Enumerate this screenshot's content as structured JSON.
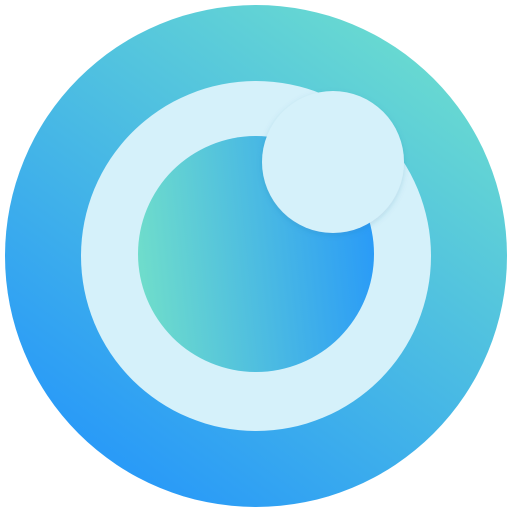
{
  "app_icon": {
    "icon_name": "eye-lens-app-icon",
    "colors": {
      "background": "#ffffff",
      "outer_gradient_start": "#6ADBD0",
      "outer_gradient_end": "#2A9BF7",
      "ring": "#D5F1FA",
      "pupil_gradient_start": "#6FDDCB",
      "pupil_gradient_end": "#2A9BF7"
    }
  }
}
